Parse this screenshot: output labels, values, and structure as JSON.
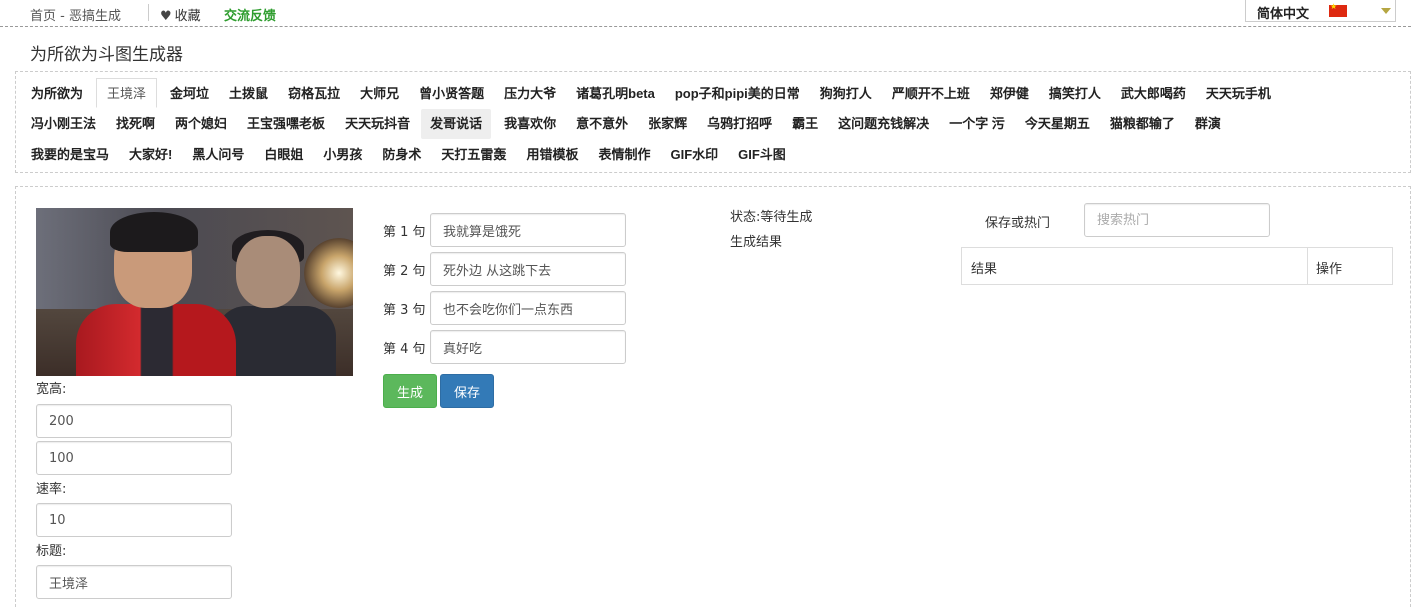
{
  "topbar": {
    "breadcrumb": "首页 - 恶搞生成",
    "favorite_label": "收藏",
    "feedback_label": "交流反馈",
    "language": "简体中文"
  },
  "page_title": "为所欲为斗图生成器",
  "template_nav": {
    "rows": [
      [
        "为所欲为",
        "王境泽",
        "金坷垃",
        "土拨鼠",
        "窃格瓦拉",
        "大师兄",
        "曾小贤答题",
        "压力大爷",
        "诸葛孔明beta",
        "pop子和pipi美的日常",
        "狗狗打人",
        "严顺开不上班",
        "郑伊健",
        "搞笑打人",
        "武大郎喝药",
        "天天玩手机"
      ],
      [
        "冯小刚王法",
        "找死啊",
        "两个媳妇",
        "王宝强嘿老板",
        "天天玩抖音",
        "发哥说话",
        "我喜欢你",
        "意不意外",
        "张家辉",
        "乌鸦打招呼",
        "霸王",
        "这问题充钱解决",
        "一个字 污",
        "今天星期五",
        "猫粮都输了",
        "群演"
      ],
      [
        "我要的是宝马",
        "大家好!",
        "黑人问号",
        "白眼姐",
        "小男孩",
        "防身术",
        "天打五雷轰",
        "用错模板",
        "表情制作",
        "GIF水印",
        "GIF斗图"
      ]
    ],
    "active": "王境泽",
    "highlighted": "发哥说话"
  },
  "settings": {
    "size_label": "宽高:",
    "width": "200",
    "height": "100",
    "rate_label": "速率:",
    "rate": "10",
    "title_label": "标题:",
    "title_value": "王境泽"
  },
  "sentences": [
    {
      "label": "第 1 句",
      "value": "我就算是饿死"
    },
    {
      "label": "第 2 句",
      "value": "死外边 从这跳下去"
    },
    {
      "label": "第 3 句",
      "value": "也不会吃你们一点东西"
    },
    {
      "label": "第 4 句",
      "value": "真好吃"
    }
  ],
  "buttons": {
    "generate": "生成",
    "save": "保存"
  },
  "status": {
    "state": "状态:等待生成",
    "result_label": "生成结果"
  },
  "hot": {
    "label": "保存或热门",
    "search_placeholder": "搜索热门"
  },
  "result_table": {
    "headers": [
      "结果",
      "操作"
    ]
  },
  "colors": {
    "generate_button": "#5cb85c",
    "save_button": "#337ab7",
    "feedback_link": "#2e9d2e"
  }
}
